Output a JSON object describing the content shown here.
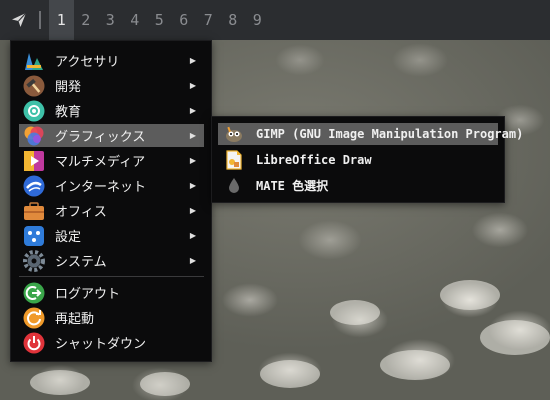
{
  "panel": {
    "launcher_icon": "paper-plane-icon",
    "workspaces": [
      "1",
      "2",
      "3",
      "4",
      "5",
      "6",
      "7",
      "8",
      "9"
    ],
    "active_workspace": "1"
  },
  "menu": {
    "items": [
      {
        "label": "アクセサリ",
        "icon": "accessories-icon"
      },
      {
        "label": "開発",
        "icon": "hammer-icon"
      },
      {
        "label": "教育",
        "icon": "education-icon"
      },
      {
        "label": "グラフィックス",
        "icon": "graphics-icon"
      },
      {
        "label": "マルチメディア",
        "icon": "multimedia-icon"
      },
      {
        "label": "インターネット",
        "icon": "internet-icon"
      },
      {
        "label": "オフィス",
        "icon": "office-briefcase-icon"
      },
      {
        "label": "設定",
        "icon": "settings-icon"
      },
      {
        "label": "システム",
        "icon": "system-gear-icon"
      }
    ],
    "actions": [
      {
        "label": "ログアウト",
        "icon": "logout-icon"
      },
      {
        "label": "再起動",
        "icon": "restart-icon"
      },
      {
        "label": "シャットダウン",
        "icon": "power-icon"
      }
    ],
    "highlighted": "グラフィックス"
  },
  "submenu": {
    "items": [
      {
        "label": "GIMP (GNU Image Manipulation Program)",
        "icon": "gimp-icon"
      },
      {
        "label": "LibreOffice Draw",
        "icon": "libreoffice-draw-icon"
      },
      {
        "label": "MATE 色選択",
        "icon": "color-picker-drop-icon"
      }
    ],
    "highlighted": "GIMP (GNU Image Manipulation Program)"
  },
  "colors": {
    "panel_bg": "#2b2d30",
    "menu_bg": "#0b0b0c",
    "highlight": "#5c5c5c"
  }
}
